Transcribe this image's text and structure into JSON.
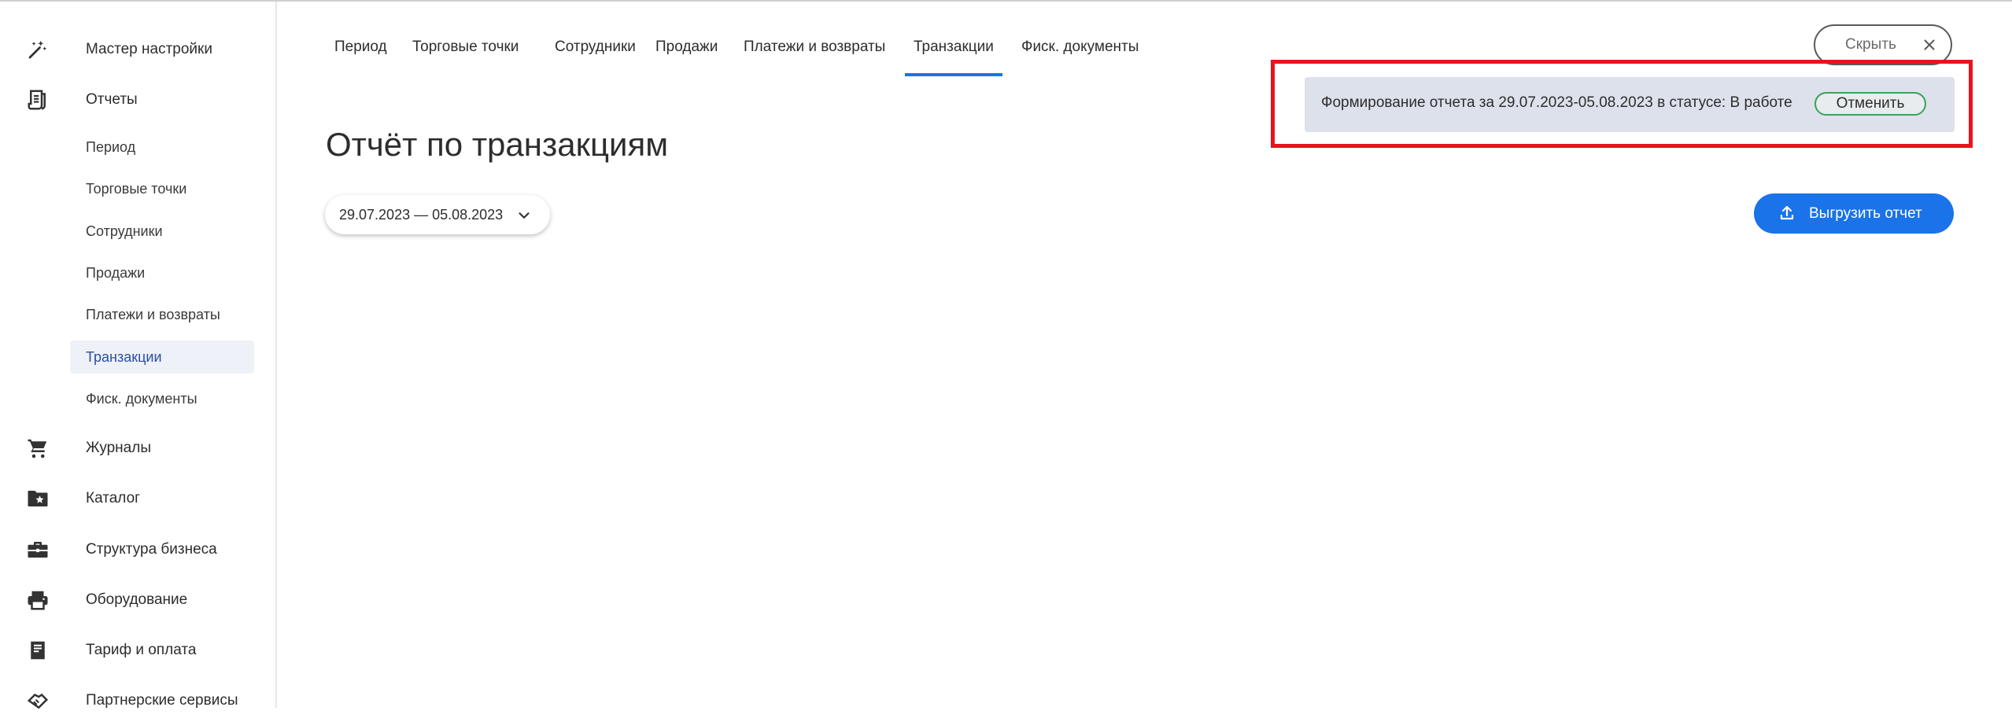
{
  "sidebar": {
    "items": [
      {
        "label": "Мастер настройки",
        "icon": "magic-wand-icon"
      },
      {
        "label": "Отчеты",
        "icon": "report-receipt-icon"
      },
      {
        "label": "Журналы",
        "icon": "cart-icon"
      },
      {
        "label": "Каталог",
        "icon": "folder-star-icon"
      },
      {
        "label": "Структура бизнеса",
        "icon": "briefcase-icon"
      },
      {
        "label": "Оборудование",
        "icon": "printer-icon"
      },
      {
        "label": "Тариф и оплата",
        "icon": "receipt-icon"
      },
      {
        "label": "Партнерские сервисы",
        "icon": "handshake-icon"
      }
    ],
    "reports_sub": [
      {
        "label": "Период"
      },
      {
        "label": "Торговые точки"
      },
      {
        "label": "Сотрудники"
      },
      {
        "label": "Продажи"
      },
      {
        "label": "Платежи и возвраты"
      },
      {
        "label": "Транзакции",
        "active": true
      },
      {
        "label": "Фиск. документы"
      }
    ]
  },
  "tabs": [
    {
      "label": "Период"
    },
    {
      "label": "Торговые точки"
    },
    {
      "label": "Сотрудники"
    },
    {
      "label": "Продажи"
    },
    {
      "label": "Платежи и возвраты"
    },
    {
      "label": "Транзакции",
      "active": true
    },
    {
      "label": "Фиск. документы"
    }
  ],
  "hide_button": {
    "label": "Скрыть",
    "icon": "close-icon"
  },
  "notice": {
    "message": "Формирование отчета за 29.07.2023-05.08.2023 в статусе: В работе",
    "cancel_label": "Отменить"
  },
  "page_title": "Отчёт по транзакциям",
  "period_select": {
    "value": "29.07.2023 — 05.08.2023",
    "icon": "chevron-down-icon"
  },
  "export_button": {
    "label": "Выгрузить отчет",
    "icon": "upload-icon"
  },
  "colors": {
    "accent": "#1a73e8",
    "highlight_border": "#e8141c",
    "notice_bg": "#dde1ec",
    "active_sub_bg": "#eef1f7",
    "cancel_border": "#3aa35a"
  }
}
